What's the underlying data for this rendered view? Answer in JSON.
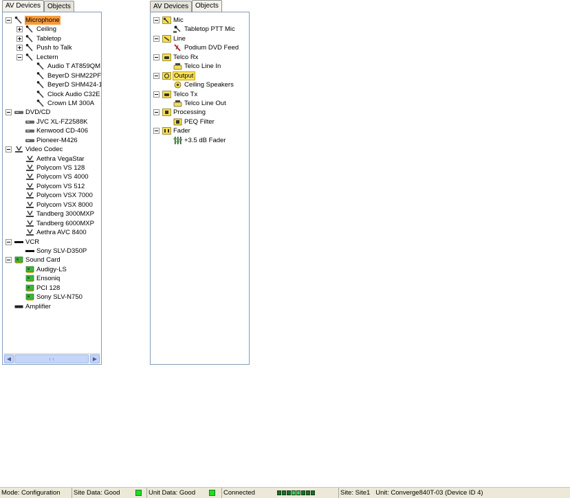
{
  "left_panel": {
    "tabs": [
      {
        "label": "AV Devices",
        "active": true
      },
      {
        "label": "Objects",
        "active": false
      }
    ],
    "tree": [
      {
        "label": "Microphone",
        "icon": "microphone-icon",
        "depth": 0,
        "expander": "minus",
        "selected": "orange"
      },
      {
        "label": "Ceiling",
        "icon": "microphone-icon",
        "depth": 1,
        "expander": "plus"
      },
      {
        "label": "Tabletop",
        "icon": "microphone-icon",
        "depth": 1,
        "expander": "plus"
      },
      {
        "label": "Push to Talk",
        "icon": "microphone-icon",
        "depth": 1,
        "expander": "plus"
      },
      {
        "label": "Lectern",
        "icon": "microphone-icon",
        "depth": 1,
        "expander": "minus"
      },
      {
        "label": "Audio T AT859QM",
        "icon": "microphone-icon",
        "depth": 2
      },
      {
        "label": "BeyerD SHM22PF",
        "icon": "microphone-icon",
        "depth": 2
      },
      {
        "label": "BeyerD SHM424-1",
        "icon": "microphone-icon",
        "depth": 2
      },
      {
        "label": "Clock Audio C32E",
        "icon": "microphone-icon",
        "depth": 2
      },
      {
        "label": "Crown LM 300A",
        "icon": "microphone-icon",
        "depth": 2
      },
      {
        "label": "DVD/CD",
        "icon": "dvd-player-icon",
        "depth": 0,
        "expander": "minus"
      },
      {
        "label": "JVC XL-FZ2588K",
        "icon": "dvd-player-icon",
        "depth": 1
      },
      {
        "label": "Kenwood CD-406",
        "icon": "dvd-player-icon",
        "depth": 1
      },
      {
        "label": "Pioneer-M426",
        "icon": "dvd-player-icon",
        "depth": 1
      },
      {
        "label": "Video Codec",
        "icon": "video-codec-icon",
        "depth": 0,
        "expander": "minus"
      },
      {
        "label": "Aethra VegaStar",
        "icon": "video-codec-icon",
        "depth": 1
      },
      {
        "label": "Polycom VS 128",
        "icon": "video-codec-icon",
        "depth": 1
      },
      {
        "label": "Polycom VS 4000",
        "icon": "video-codec-icon",
        "depth": 1
      },
      {
        "label": "Polycom VS 512",
        "icon": "video-codec-icon",
        "depth": 1
      },
      {
        "label": "Polycom VSX 7000",
        "icon": "video-codec-icon",
        "depth": 1
      },
      {
        "label": "Polycom VSX 8000",
        "icon": "video-codec-icon",
        "depth": 1
      },
      {
        "label": "Tandberg 3000MXP",
        "icon": "video-codec-icon",
        "depth": 1
      },
      {
        "label": "Tandberg 6000MXP",
        "icon": "video-codec-icon",
        "depth": 1
      },
      {
        "label": "Aethra AVC 8400",
        "icon": "video-codec-icon",
        "depth": 1
      },
      {
        "label": "VCR",
        "icon": "vcr-icon",
        "depth": 0,
        "expander": "minus"
      },
      {
        "label": "Sony SLV-D350P",
        "icon": "vcr-icon",
        "depth": 1
      },
      {
        "label": "Sound Card",
        "icon": "sound-card-icon",
        "depth": 0,
        "expander": "minus"
      },
      {
        "label": "Audigy-LS",
        "icon": "sound-card-icon",
        "depth": 1
      },
      {
        "label": "Ensoniq",
        "icon": "sound-card-icon",
        "depth": 1
      },
      {
        "label": "PCI 128",
        "icon": "sound-card-icon",
        "depth": 1
      },
      {
        "label": "Sony SLV-N750",
        "icon": "sound-card-icon",
        "depth": 1
      },
      {
        "label": "Amplifier",
        "icon": "amplifier-icon",
        "depth": 0
      }
    ]
  },
  "right_panel": {
    "tabs": [
      {
        "label": "AV Devices",
        "active": false
      },
      {
        "label": "Objects",
        "active": true
      }
    ],
    "tree": [
      {
        "label": "Mic",
        "icon": "mic-group-icon",
        "depth": 0,
        "expander": "minus"
      },
      {
        "label": "Tabletop PTT Mic",
        "icon": "ptt-mic-icon",
        "depth": 1
      },
      {
        "label": "Line",
        "icon": "line-group-icon",
        "depth": 0,
        "expander": "minus"
      },
      {
        "label": "Podium DVD Feed",
        "icon": "dvd-feed-icon",
        "depth": 1
      },
      {
        "label": "Telco Rx",
        "icon": "telco-group-icon",
        "depth": 0,
        "expander": "minus"
      },
      {
        "label": "Telco Line In",
        "icon": "telco-line-icon",
        "depth": 1
      },
      {
        "label": "Output",
        "icon": "output-group-icon",
        "depth": 0,
        "expander": "minus",
        "selected": "yellow"
      },
      {
        "label": "Ceiling Speakers",
        "icon": "speaker-icon",
        "depth": 1
      },
      {
        "label": "Telco Tx",
        "icon": "telco-group-icon",
        "depth": 0,
        "expander": "minus"
      },
      {
        "label": "Telco Line Out",
        "icon": "telco-line-icon",
        "depth": 1
      },
      {
        "label": "Processing",
        "icon": "processing-group-icon",
        "depth": 0,
        "expander": "minus"
      },
      {
        "label": "PEQ Filter",
        "icon": "filter-icon",
        "depth": 1
      },
      {
        "label": "Fader",
        "icon": "fader-group-icon",
        "depth": 0,
        "expander": "minus"
      },
      {
        "label": "+3.5 dB Fader",
        "icon": "fader-icon",
        "depth": 1
      }
    ]
  },
  "statusbar": {
    "mode": "Mode: Configuration",
    "site_data": "Site Data: Good",
    "unit_data": "Unit Data: Good",
    "connected": "Connected",
    "site_unit": "Site: Site1   Unit: Converge840T-03 (Device ID 4)",
    "meter_lit": [
      false,
      false,
      false,
      true,
      true,
      false,
      false,
      false
    ]
  },
  "colors": {
    "selection_orange": "#f79a3e",
    "selection_yellow": "#ffe45c",
    "led_green": "#22dd22",
    "tree_border": "#7f9db9"
  }
}
